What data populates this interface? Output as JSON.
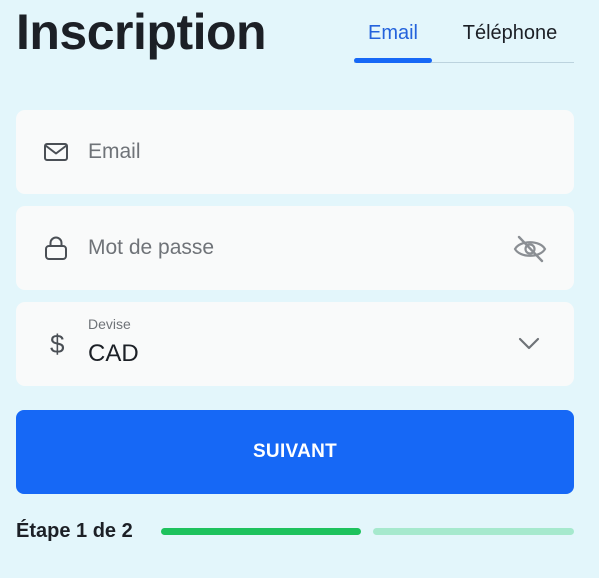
{
  "header": {
    "title": "Inscription"
  },
  "tabs": [
    {
      "label": "Email",
      "active": true
    },
    {
      "label": "Téléphone",
      "active": false
    }
  ],
  "form": {
    "email": {
      "icon": "mail-icon",
      "placeholder": "Email",
      "value": ""
    },
    "password": {
      "icon": "lock-icon",
      "placeholder": "Mot de passe",
      "value": "",
      "toggle_icon": "eye-off-icon"
    },
    "currency": {
      "icon": "dollar-icon",
      "symbol": "$",
      "label": "Devise",
      "value": "CAD",
      "dropdown_icon": "chevron-down-icon"
    }
  },
  "submit": {
    "label": "SUIVANT"
  },
  "progress": {
    "label": "Étape 1 de 2",
    "current_step": 1,
    "total_steps": 2
  },
  "colors": {
    "background": "#e3f6fb",
    "accent": "#1668f6",
    "progress_done": "#1ec25d",
    "progress_todo": "#a6e9cd",
    "field_bg": "#f9fafa"
  }
}
